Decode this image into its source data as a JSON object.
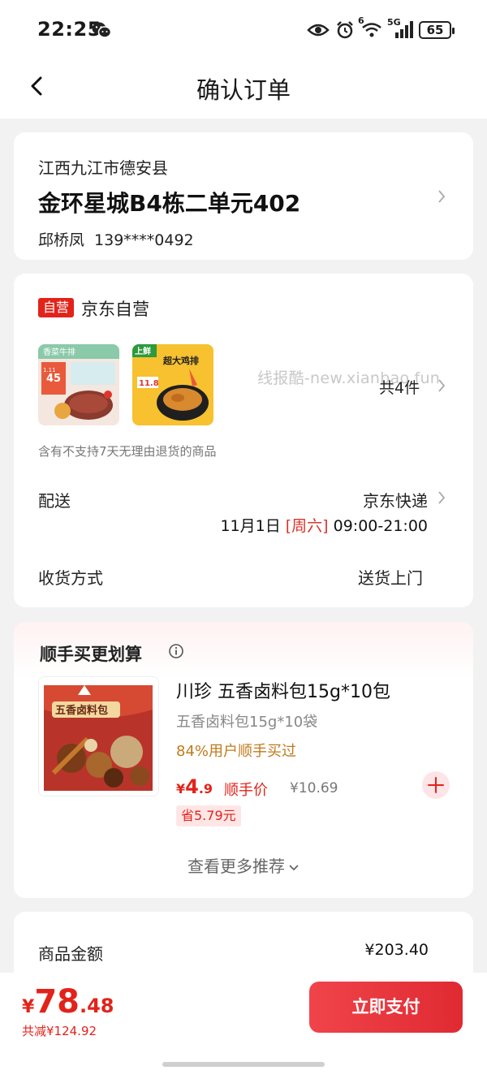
{
  "status_bar": {
    "time": "22:25",
    "network": "5G",
    "wifi_sub": "6",
    "battery": "65"
  },
  "nav": {
    "title": "确认订单",
    "back_icon": "chevron-left-icon"
  },
  "address": {
    "region": "江西九江市德安县",
    "detail": "金环星城B4栋二单元402",
    "name": "邱桥凤",
    "phone": "139****0492"
  },
  "order": {
    "badge": "自营",
    "store": "京东自营",
    "watermark": "线报酷-new.xianbao.fun",
    "total_items": "共4件",
    "return_notice": "含有不支持7天无理由退货的商品",
    "thumb1_lines": [
      "香菜牛排",
      "45",
      "1.11"
    ],
    "thumb2_lines": [
      "上鲜",
      "超大鸡排",
      "11.8"
    ],
    "delivery_label": "配送",
    "delivery_carrier": "京东快递",
    "delivery_date": "11月1日",
    "delivery_weekday": "[周六]",
    "delivery_window": "09:00-21:00",
    "receive_label": "收货方式",
    "receive_method": "送货上门"
  },
  "recommend": {
    "title": "顺手买更划算",
    "product_name": "川珍 五香卤料包15g*10包",
    "product_spec": "五香卤料包15g*10袋",
    "bought": "84%用户顺手买过",
    "price_currency": "¥",
    "price_int": "4",
    "price_dec": ".9",
    "price_label": "顺手价",
    "orig_price": "¥10.69",
    "save": "省5.79元",
    "image_text": "五香卤料包",
    "more": "查看更多推荐"
  },
  "amount": {
    "label": "商品金额",
    "value": "¥203.40"
  },
  "footer": {
    "currency": "¥",
    "total_int": "78",
    "total_dec": ".48",
    "saved": "共减¥124.92",
    "pay_button": "立即支付"
  },
  "colors": {
    "accent": "#e2231a",
    "background": "#f2f2f2"
  }
}
